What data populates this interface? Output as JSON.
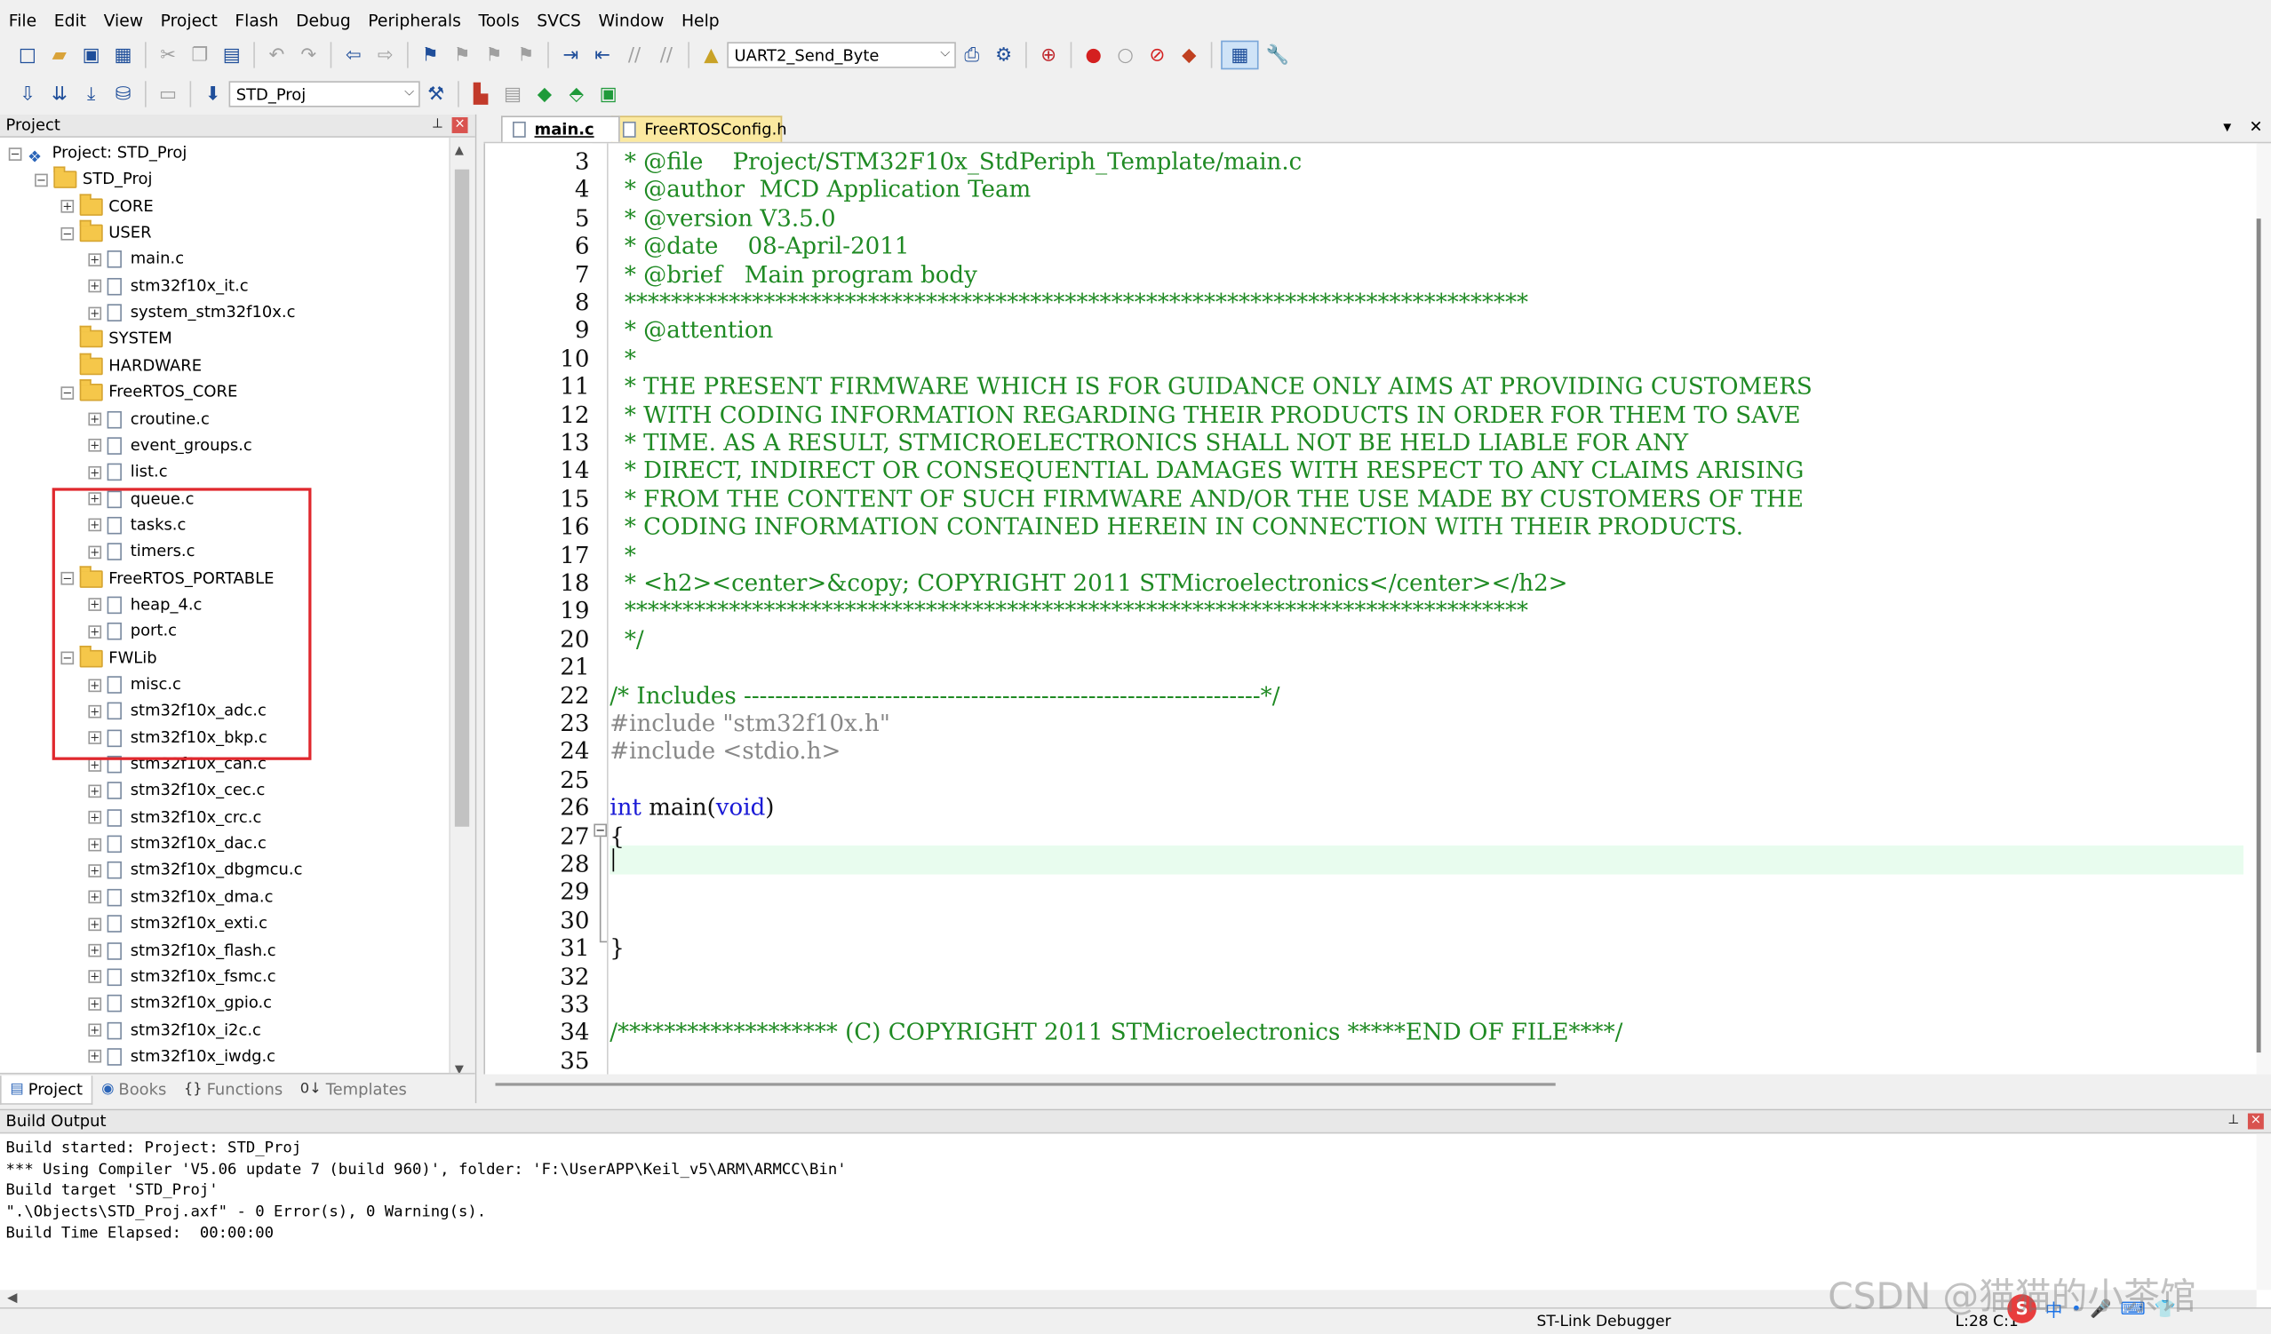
{
  "menu": [
    "File",
    "Edit",
    "View",
    "Project",
    "Flash",
    "Debug",
    "Peripherals",
    "Tools",
    "SVCS",
    "Window",
    "Help"
  ],
  "toolbar": {
    "function_combo": "UART2_Send_Byte",
    "target_combo": "STD_Proj"
  },
  "project_panel": {
    "title": "Project",
    "tree": [
      {
        "label": "Project: STD_Proj",
        "level": 0,
        "type": "project",
        "exp": "−"
      },
      {
        "label": "STD_Proj",
        "level": 1,
        "type": "folder",
        "exp": "−"
      },
      {
        "label": "CORE",
        "level": 2,
        "type": "folder",
        "exp": "+"
      },
      {
        "label": "USER",
        "level": 2,
        "type": "folder",
        "exp": "−"
      },
      {
        "label": "main.c",
        "level": 3,
        "type": "file",
        "exp": "+"
      },
      {
        "label": "stm32f10x_it.c",
        "level": 3,
        "type": "file",
        "exp": "+"
      },
      {
        "label": "system_stm32f10x.c",
        "level": 3,
        "type": "file",
        "exp": "+"
      },
      {
        "label": "SYSTEM",
        "level": 2,
        "type": "folder",
        "exp": ""
      },
      {
        "label": "HARDWARE",
        "level": 2,
        "type": "folder",
        "exp": ""
      },
      {
        "label": "FreeRTOS_CORE",
        "level": 2,
        "type": "folder",
        "exp": "−"
      },
      {
        "label": "croutine.c",
        "level": 3,
        "type": "file",
        "exp": "+"
      },
      {
        "label": "event_groups.c",
        "level": 3,
        "type": "file",
        "exp": "+"
      },
      {
        "label": "list.c",
        "level": 3,
        "type": "file",
        "exp": "+"
      },
      {
        "label": "queue.c",
        "level": 3,
        "type": "file",
        "exp": "+"
      },
      {
        "label": "tasks.c",
        "level": 3,
        "type": "file",
        "exp": "+"
      },
      {
        "label": "timers.c",
        "level": 3,
        "type": "file",
        "exp": "+"
      },
      {
        "label": "FreeRTOS_PORTABLE",
        "level": 2,
        "type": "folder",
        "exp": "−"
      },
      {
        "label": "heap_4.c",
        "level": 3,
        "type": "file",
        "exp": "+"
      },
      {
        "label": "port.c",
        "level": 3,
        "type": "file",
        "exp": "+"
      },
      {
        "label": "FWLib",
        "level": 2,
        "type": "folder",
        "exp": "−"
      },
      {
        "label": "misc.c",
        "level": 3,
        "type": "file",
        "exp": "+"
      },
      {
        "label": "stm32f10x_adc.c",
        "level": 3,
        "type": "file",
        "exp": "+"
      },
      {
        "label": "stm32f10x_bkp.c",
        "level": 3,
        "type": "file",
        "exp": "+"
      },
      {
        "label": "stm32f10x_can.c",
        "level": 3,
        "type": "file",
        "exp": "+"
      },
      {
        "label": "stm32f10x_cec.c",
        "level": 3,
        "type": "file",
        "exp": "+"
      },
      {
        "label": "stm32f10x_crc.c",
        "level": 3,
        "type": "file",
        "exp": "+"
      },
      {
        "label": "stm32f10x_dac.c",
        "level": 3,
        "type": "file",
        "exp": "+"
      },
      {
        "label": "stm32f10x_dbgmcu.c",
        "level": 3,
        "type": "file",
        "exp": "+"
      },
      {
        "label": "stm32f10x_dma.c",
        "level": 3,
        "type": "file",
        "exp": "+"
      },
      {
        "label": "stm32f10x_exti.c",
        "level": 3,
        "type": "file",
        "exp": "+"
      },
      {
        "label": "stm32f10x_flash.c",
        "level": 3,
        "type": "file",
        "exp": "+"
      },
      {
        "label": "stm32f10x_fsmc.c",
        "level": 3,
        "type": "file",
        "exp": "+"
      },
      {
        "label": "stm32f10x_gpio.c",
        "level": 3,
        "type": "file",
        "exp": "+"
      },
      {
        "label": "stm32f10x_i2c.c",
        "level": 3,
        "type": "file",
        "exp": "+"
      },
      {
        "label": "stm32f10x_iwdg.c",
        "level": 3,
        "type": "file",
        "exp": "+"
      }
    ],
    "tabs": [
      {
        "label": "Project",
        "icon": "▤"
      },
      {
        "label": "Books",
        "icon": "◉"
      },
      {
        "label": "Functions",
        "icon": "{}"
      },
      {
        "label": "Templates",
        "icon": "0↓"
      }
    ]
  },
  "editor": {
    "tabs": [
      "main.c",
      "FreeRTOSConfig.h"
    ],
    "lines": [
      {
        "n": "3",
        "t": "  * @file    Project/STM32F10x_StdPeriph_Template/main.c",
        "c": "cm"
      },
      {
        "n": "4",
        "t": "  * @author  MCD Application Team",
        "c": "cm"
      },
      {
        "n": "5",
        "t": "  * @version V3.5.0",
        "c": "cm"
      },
      {
        "n": "6",
        "t": "  * @date    08-April-2011",
        "c": "cm"
      },
      {
        "n": "7",
        "t": "  * @brief   Main program body",
        "c": "cm"
      },
      {
        "n": "8",
        "t": "  ******************************************************************************",
        "c": "cm"
      },
      {
        "n": "9",
        "t": "  * @attention",
        "c": "cm"
      },
      {
        "n": "10",
        "t": "  *",
        "c": "cm"
      },
      {
        "n": "11",
        "t": "  * THE PRESENT FIRMWARE WHICH IS FOR GUIDANCE ONLY AIMS AT PROVIDING CUSTOMERS",
        "c": "cm"
      },
      {
        "n": "12",
        "t": "  * WITH CODING INFORMATION REGARDING THEIR PRODUCTS IN ORDER FOR THEM TO SAVE",
        "c": "cm"
      },
      {
        "n": "13",
        "t": "  * TIME. AS A RESULT, STMICROELECTRONICS SHALL NOT BE HELD LIABLE FOR ANY",
        "c": "cm"
      },
      {
        "n": "14",
        "t": "  * DIRECT, INDIRECT OR CONSEQUENTIAL DAMAGES WITH RESPECT TO ANY CLAIMS ARISING",
        "c": "cm"
      },
      {
        "n": "15",
        "t": "  * FROM THE CONTENT OF SUCH FIRMWARE AND/OR THE USE MADE BY CUSTOMERS OF THE",
        "c": "cm"
      },
      {
        "n": "16",
        "t": "  * CODING INFORMATION CONTAINED HEREIN IN CONNECTION WITH THEIR PRODUCTS.",
        "c": "cm"
      },
      {
        "n": "17",
        "t": "  *",
        "c": "cm"
      },
      {
        "n": "18",
        "t": "  * <h2><center>&copy; COPYRIGHT 2011 STMicroelectronics</center></h2>",
        "c": "cm"
      },
      {
        "n": "19",
        "t": "  ******************************************************************************",
        "c": "cm"
      },
      {
        "n": "20",
        "t": "  */",
        "c": "cm"
      },
      {
        "n": "21",
        "t": "",
        "c": "tx"
      },
      {
        "n": "22",
        "t": "/* Includes ------------------------------------------------------------------*/",
        "c": "cm"
      },
      {
        "n": "23",
        "t": "#include \"stm32f10x.h\"",
        "c": "pp"
      },
      {
        "n": "24",
        "t": "#include <stdio.h>",
        "c": "pp"
      },
      {
        "n": "25",
        "t": "",
        "c": "tx"
      },
      {
        "n": "26",
        "t": "int main(void)",
        "c": "main"
      },
      {
        "n": "27",
        "t": "{",
        "c": "tx"
      },
      {
        "n": "28",
        "t": "",
        "c": "tx"
      },
      {
        "n": "29",
        "t": "",
        "c": "tx"
      },
      {
        "n": "30",
        "t": "",
        "c": "tx"
      },
      {
        "n": "31",
        "t": "}",
        "c": "tx"
      },
      {
        "n": "32",
        "t": "",
        "c": "tx"
      },
      {
        "n": "33",
        "t": "",
        "c": "tx"
      },
      {
        "n": "34",
        "t": "/******************* (C) COPYRIGHT 2011 STMicroelectronics *****END OF FILE****/",
        "c": "cm"
      },
      {
        "n": "35",
        "t": "",
        "c": "tx"
      }
    ]
  },
  "build_output": {
    "title": "Build Output",
    "lines": [
      "Build started: Project: STD_Proj",
      "*** Using Compiler 'V5.06 update 7 (build 960)', folder: 'F:\\UserAPP\\Keil_v5\\ARM\\ARMCC\\Bin'",
      "Build target 'STD_Proj'",
      "\".\\Objects\\STD_Proj.axf\" - 0 Error(s), 0 Warning(s).",
      "Build Time Elapsed:  00:00:00"
    ]
  },
  "status": {
    "debugger": "ST-Link Debugger",
    "position": "L:28 C:1"
  },
  "watermark": "CSDN @猫猫的小茶馆",
  "colors": {
    "comment": "#1f8a23",
    "keyword": "#1a1ad6",
    "preprocessor": "#888888",
    "highlight_box": "#e0282e",
    "current_line": "#e8fcee"
  }
}
